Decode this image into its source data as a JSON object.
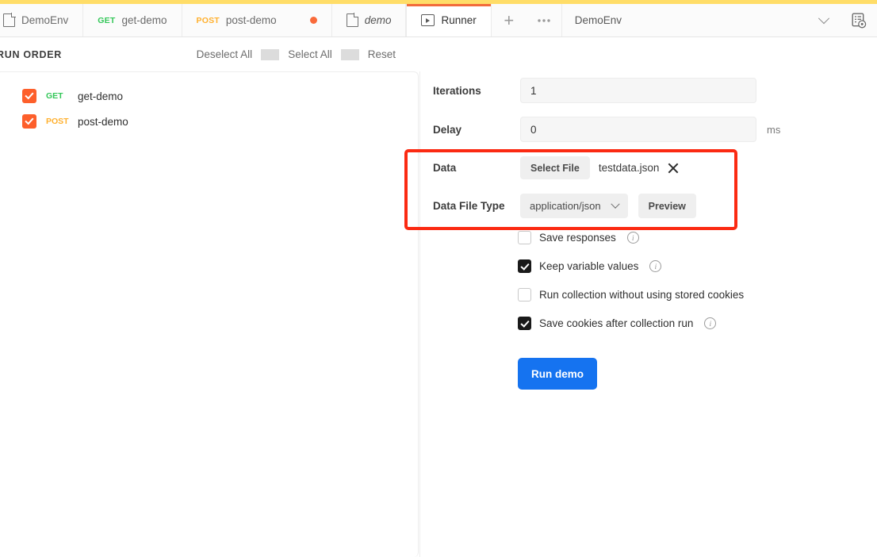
{
  "window": {
    "accent_stripe_color": "#ffdd68",
    "active_tab_indicator_color": "#f26b3a"
  },
  "tabbar": {
    "tabs": [
      {
        "id": "env-tab",
        "icon": "document-icon",
        "label": "DemoEnv",
        "method": "",
        "italic": false,
        "active": false,
        "unsaved": false
      },
      {
        "id": "get-demo-tab",
        "icon": "",
        "label": "get-demo",
        "method": "GET",
        "italic": false,
        "active": false,
        "unsaved": false
      },
      {
        "id": "post-demo-tab",
        "icon": "",
        "label": "post-demo",
        "method": "POST",
        "italic": false,
        "active": false,
        "unsaved": true
      },
      {
        "id": "demo-tab",
        "icon": "folder-icon",
        "label": "demo",
        "method": "",
        "italic": true,
        "active": false,
        "unsaved": false
      },
      {
        "id": "runner-tab",
        "icon": "play-icon",
        "label": "Runner",
        "method": "",
        "italic": false,
        "active": true,
        "unsaved": false
      }
    ],
    "new_tab_label": "+",
    "more_label": "●●●",
    "environment": "DemoEnv",
    "env_eye_icon": "environment-quick-look-icon"
  },
  "run_order": {
    "title": "RUN ORDER",
    "actions": [
      "Deselect All",
      "Select All",
      "Reset"
    ],
    "requests": [
      {
        "checked": true,
        "method": "GET",
        "name": "get-demo"
      },
      {
        "checked": true,
        "method": "POST",
        "name": "post-demo"
      }
    ]
  },
  "form": {
    "iterations": {
      "label": "Iterations",
      "value": "1"
    },
    "delay": {
      "label": "Delay",
      "value": "0",
      "unit": "ms"
    },
    "data": {
      "label": "Data",
      "select_file_label": "Select File",
      "file_name": "testdata.json",
      "clear_icon": "close-icon"
    },
    "data_file_type": {
      "label": "Data File Type",
      "value": "application/json",
      "preview_label": "Preview"
    },
    "options": [
      {
        "checked": false,
        "label": "Save responses",
        "info": true
      },
      {
        "checked": true,
        "label": "Keep variable values",
        "info": true
      },
      {
        "checked": false,
        "label": "Run collection without using stored cookies",
        "info": false
      },
      {
        "checked": true,
        "label": "Save cookies after collection run",
        "info": true
      }
    ],
    "run_button": {
      "label": "Run demo",
      "color": "#1573f0"
    }
  },
  "annotation": {
    "color": "#fb2a12"
  }
}
